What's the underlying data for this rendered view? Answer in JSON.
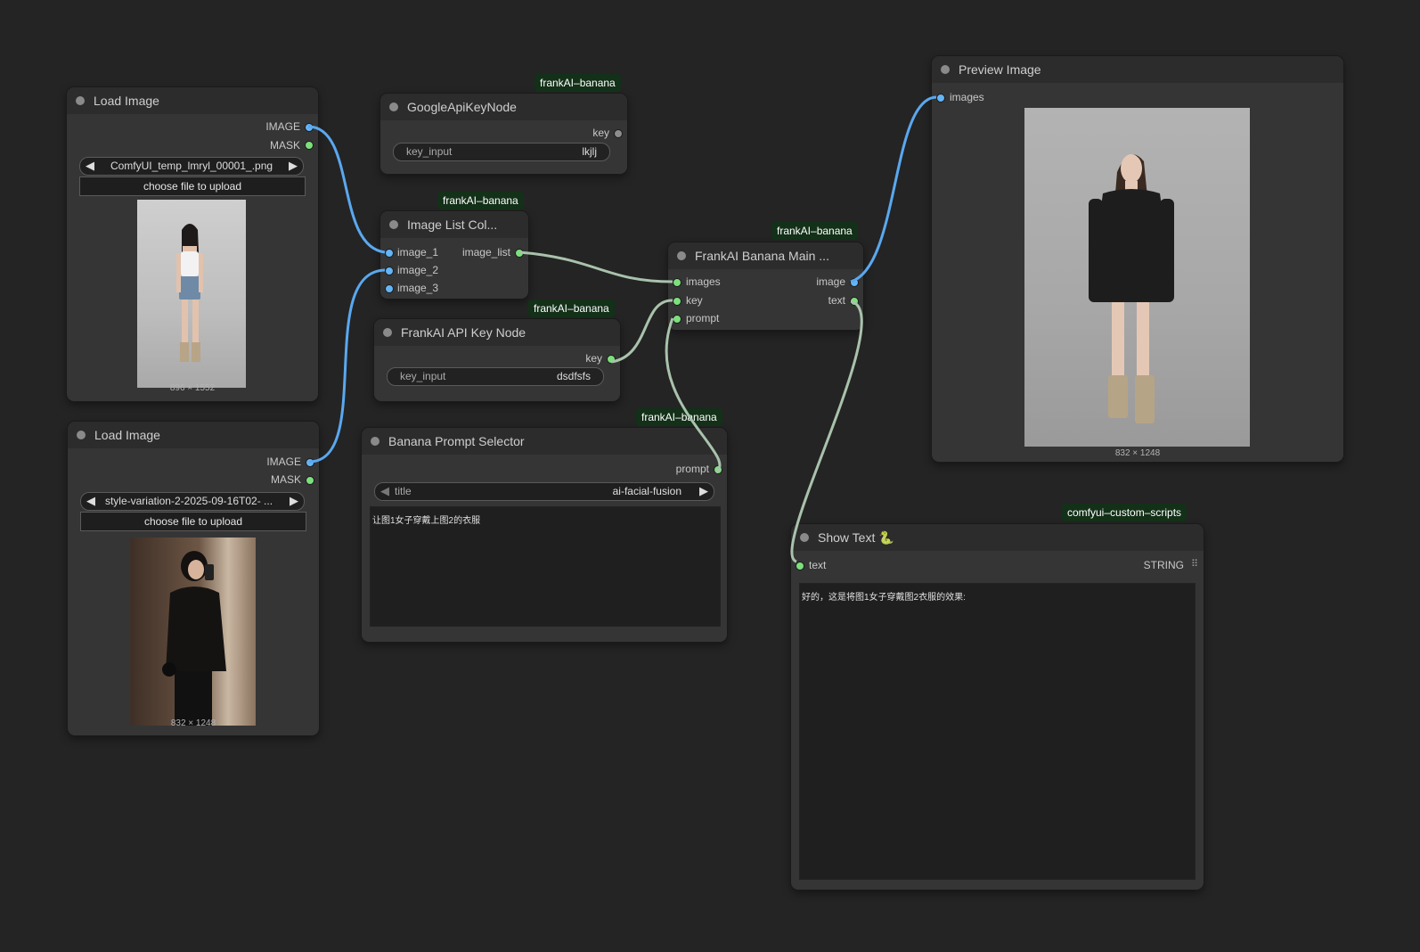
{
  "colors": {
    "canvas": "#242424",
    "node_bg": "#353535",
    "badge_bg": "#133018",
    "image_port": "#64b5f6",
    "data_port": "#7ce07c",
    "image_wire": "#5aa8ef",
    "data_wire": "#a9c2ac"
  },
  "load_image_1": {
    "title": "Load Image",
    "out_image": "IMAGE",
    "out_mask": "MASK",
    "filename": "ComfyUI_temp_lmryl_00001_.png",
    "upload_label": "choose file to upload",
    "dimensions": "896 × 1552",
    "preview_desc": "woman-in-white-tank-denim-shorts"
  },
  "load_image_2": {
    "title": "Load Image",
    "out_image": "IMAGE",
    "out_mask": "MASK",
    "filename": "style-variation-2-2025-09-16T02- ...",
    "upload_label": "choose file to upload",
    "dimensions": "832 × 1248",
    "preview_desc": "woman-in-black-sweater-selfie"
  },
  "google_api_key": {
    "badge": "frankAI–banana",
    "title": "GoogleApiKeyNode",
    "out_key": "key",
    "widget_label": "key_input",
    "widget_value": "lkjlj"
  },
  "image_list": {
    "badge": "frankAI–banana",
    "title": "Image List Col...",
    "in_1": "image_1",
    "in_2": "image_2",
    "in_3": "image_3",
    "out": "image_list"
  },
  "frankai_api_key": {
    "badge": "frankAI–banana",
    "title": "FrankAI API Key Node",
    "out_key": "key",
    "widget_label": "key_input",
    "widget_value": "dsdfsfs"
  },
  "banana_main": {
    "badge": "frankAI–banana",
    "title": "FrankAI Banana Main ...",
    "in_images": "images",
    "in_key": "key",
    "in_prompt": "prompt",
    "out_image": "image",
    "out_text": "text"
  },
  "prompt_selector": {
    "badge": "frankAI–banana",
    "title": "Banana Prompt Selector",
    "out_prompt": "prompt",
    "combo_label": "title",
    "combo_value": "ai-facial-fusion",
    "prompt_text": "让图1女子穿戴上图2的衣服"
  },
  "preview_image": {
    "title": "Preview Image",
    "in_images": "images",
    "dimensions": "832 × 1248"
  },
  "show_text": {
    "badge": "comfyui–custom–scripts",
    "title": "Show Text 🐍",
    "in_text": "text",
    "type_label": "STRING",
    "output_text": "好的，这是将图1女子穿戴图2衣服的效果:"
  }
}
